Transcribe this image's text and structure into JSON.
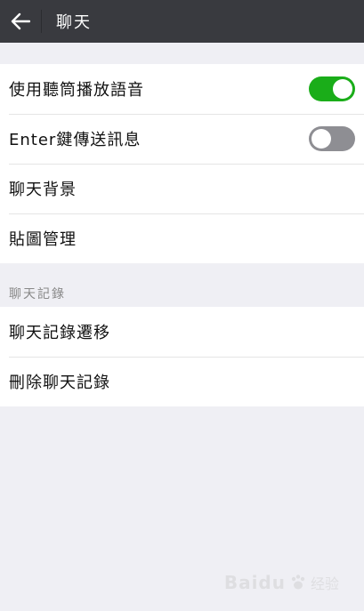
{
  "header": {
    "title": "聊天",
    "back_icon": "arrow-left-icon"
  },
  "settings": {
    "items": [
      {
        "label": "使用聽筒播放語音",
        "toggle": true
      },
      {
        "label": "Enter鍵傳送訊息",
        "toggle": false
      },
      {
        "label": "聊天背景"
      },
      {
        "label": "貼圖管理"
      }
    ]
  },
  "history": {
    "section_label": "聊天記錄",
    "items": [
      {
        "label": "聊天記錄遷移"
      },
      {
        "label": "刪除聊天記錄"
      }
    ]
  },
  "colors": {
    "topbar": "#393a3f",
    "toggle_on": "#1aad19",
    "toggle_off": "#8e8e93",
    "background": "#efeff4"
  },
  "watermark": {
    "brand": "Baidu",
    "sub": "经验"
  }
}
